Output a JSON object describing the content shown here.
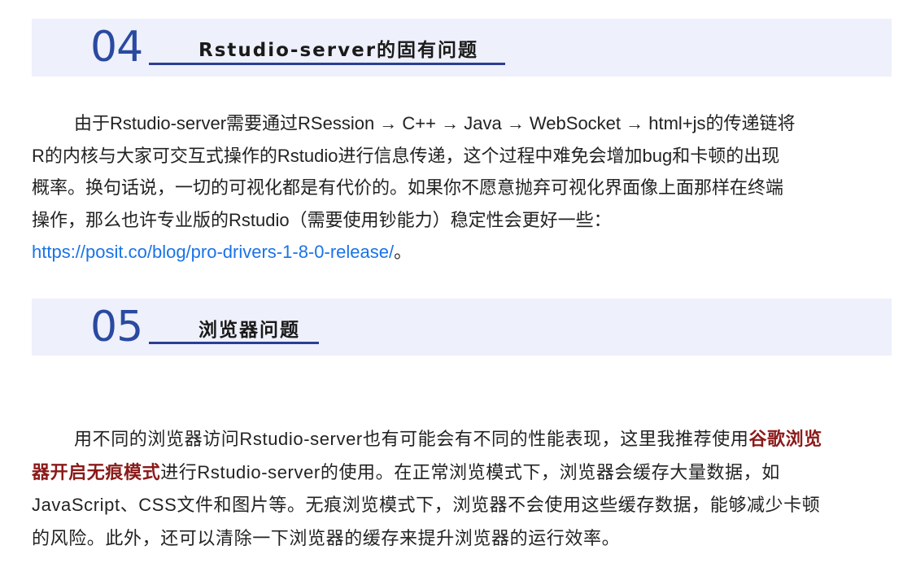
{
  "sections": [
    {
      "number": "04",
      "title": "Rstudio-server的固有问题",
      "paragraph": {
        "lines": [
          "由于Rstudio-server需要通过RSession → C++ → Java → WebSocket → html+js的传递链将",
          "R的内核与大家可交互式操作的Rstudio进行信息传递，这个过程中难免会增加bug和卡顿的出现",
          "概率。换句话说，一切的可视化都是有代价的。如果你不愿意抛弃可视化界面像上面那样在终端",
          "操作，那么也许专业版的Rstudio（需要使用钞能力）稳定性会更好一些："
        ],
        "link_text": "https://posit.co/blog/pro-drivers-1-8-0-release/",
        "link_suffix": "。"
      }
    },
    {
      "number": "05",
      "title": "浏览器问题",
      "paragraph": {
        "line1_text": "用不同的浏览器访问Rstudio-server也有可能会有不同的性能表现，这里我推荐使用",
        "highlight_part1": "谷歌浏览",
        "highlight_part2": "器开启无痕模式",
        "line2_text": "进行Rstudio-server的使用。在正常浏览模式下，浏览器会缓存大量数据，如",
        "line3": "JavaScript、CSS文件和图片等。无痕浏览模式下，浏览器不会使用这些缓存数据，能够减少卡顿",
        "line4": "的风险。此外，还可以清除一下浏览器的缓存来提升浏览器的运行效率。"
      }
    }
  ],
  "colors": {
    "header_bg": "#eef0fb",
    "accent_blue": "#2a4aa0",
    "link": "#1a73e8",
    "highlight": "#8b1a1a"
  }
}
